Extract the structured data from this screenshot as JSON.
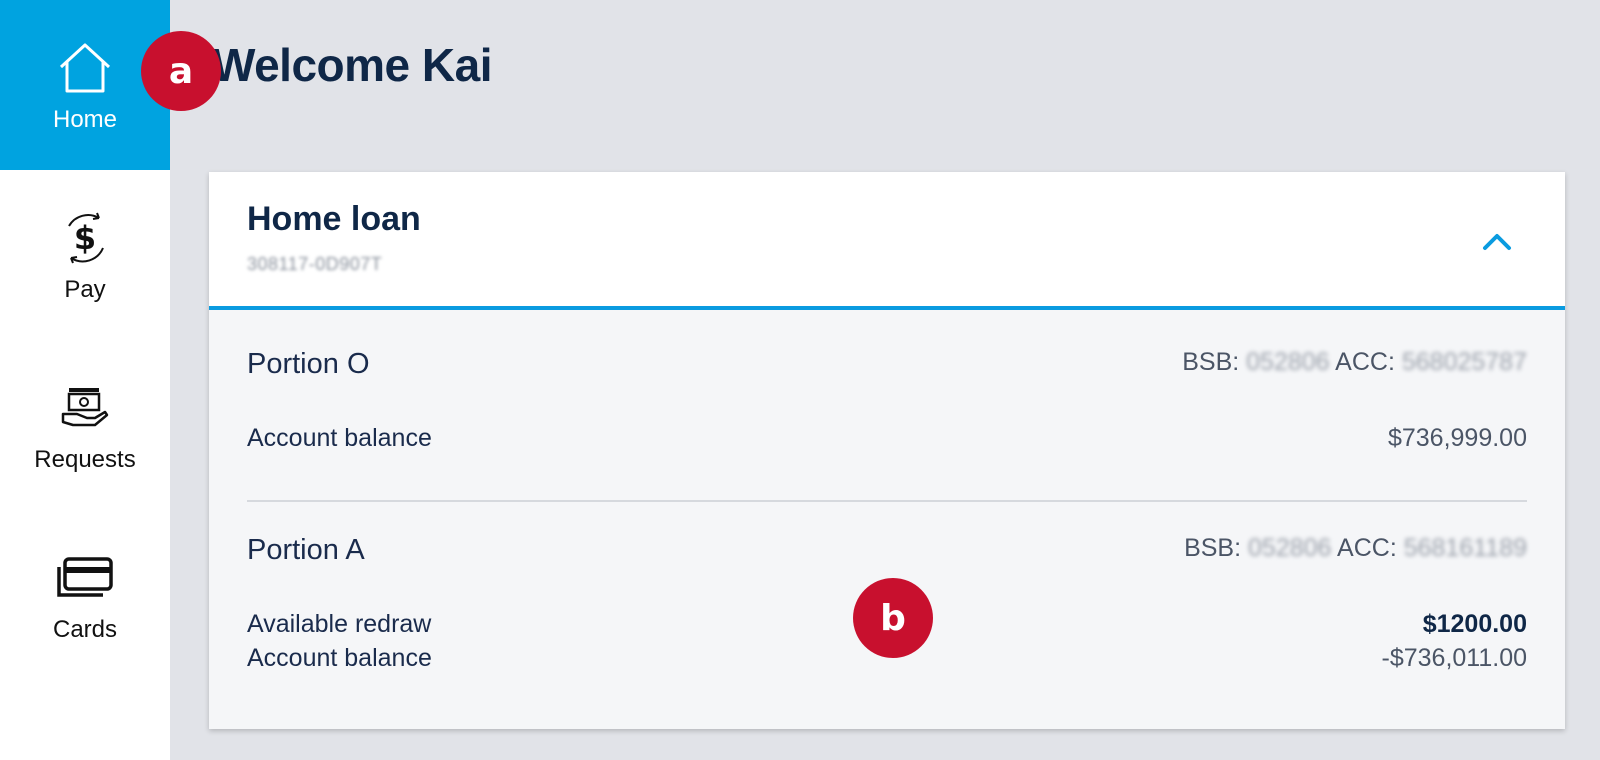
{
  "sidebar": {
    "items": [
      {
        "label": "Home",
        "icon": "home-icon",
        "active": true
      },
      {
        "label": "Pay",
        "icon": "dollar-cycle-icon"
      },
      {
        "label": "Requests",
        "icon": "hand-money-icon"
      },
      {
        "label": "Cards",
        "icon": "card-icon"
      }
    ]
  },
  "header": {
    "welcome": "Welcome Kai"
  },
  "annotations": {
    "a": "a",
    "b": "b"
  },
  "card": {
    "title": "Home loan",
    "subtitle": "308117-0D907T",
    "portions": [
      {
        "name": "Portion O",
        "bsb_label": "BSB:",
        "bsb_value": "052806",
        "acc_label": "ACC:",
        "acc_value": "568025787",
        "rows": [
          {
            "label": "Account balance",
            "value": "$736,999.00"
          }
        ]
      },
      {
        "name": "Portion A",
        "bsb_label": "BSB:",
        "bsb_value": "052806",
        "acc_label": "ACC:",
        "acc_value": "568161189",
        "rows": [
          {
            "label": "Available redraw",
            "value": "$1200.00"
          },
          {
            "label": "Account balance",
            "value": "-$736,011.00"
          }
        ]
      }
    ]
  },
  "colors": {
    "accent": "#00a3e0",
    "badge": "#c8102e",
    "navy": "#0f2747"
  }
}
